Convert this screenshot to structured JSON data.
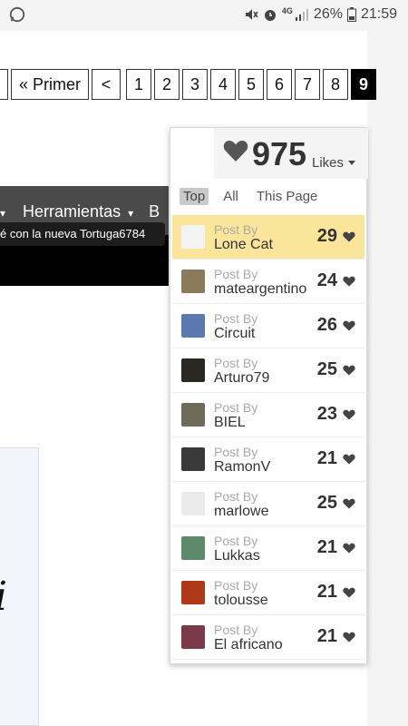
{
  "status_bar": {
    "network": "4G",
    "battery": "26%",
    "time": "21:59"
  },
  "pagination": {
    "first_label": "« Primer",
    "prev_label": "<",
    "pages": [
      "1",
      "2",
      "3",
      "4",
      "5",
      "6",
      "7",
      "8",
      "9"
    ],
    "current": "9"
  },
  "nav": {
    "menu_item": "Herramientas",
    "next_item_partial": "B",
    "ticker": "é con la nueva Tortuga6784"
  },
  "content": {
    "partial_glyph": "i"
  },
  "likes": {
    "count": "975",
    "label": "Likes",
    "tabs": [
      "Top",
      "All",
      "This Page"
    ],
    "active_tab": "Top",
    "post_by_label": "Post By",
    "rows": [
      {
        "name": "Lone Cat",
        "count": "29",
        "highlighted": true,
        "avatar_color": "#f3f3f3"
      },
      {
        "name": "mateargentino",
        "count": "24",
        "highlighted": false,
        "avatar_color": "#8a7a5a"
      },
      {
        "name": "Circuit",
        "count": "26",
        "highlighted": false,
        "avatar_color": "#5a79b0"
      },
      {
        "name": "Arturo79",
        "count": "25",
        "highlighted": false,
        "avatar_color": "#2a2622"
      },
      {
        "name": "BIEL",
        "count": "23",
        "highlighted": false,
        "avatar_color": "#6e6a5a"
      },
      {
        "name": "RamonV",
        "count": "21",
        "highlighted": false,
        "avatar_color": "#3a3a3a"
      },
      {
        "name": "marlowe",
        "count": "25",
        "highlighted": false,
        "avatar_color": "#eaeaea"
      },
      {
        "name": "Lukkas",
        "count": "21",
        "highlighted": false,
        "avatar_color": "#5d8a6a"
      },
      {
        "name": "tolousse",
        "count": "21",
        "highlighted": false,
        "avatar_color": "#b0381a"
      },
      {
        "name": "El africano",
        "count": "21",
        "highlighted": false,
        "avatar_color": "#7a3a4a"
      }
    ]
  },
  "colors": {
    "highlight": "#fbe59a",
    "active_page": "#000000"
  }
}
